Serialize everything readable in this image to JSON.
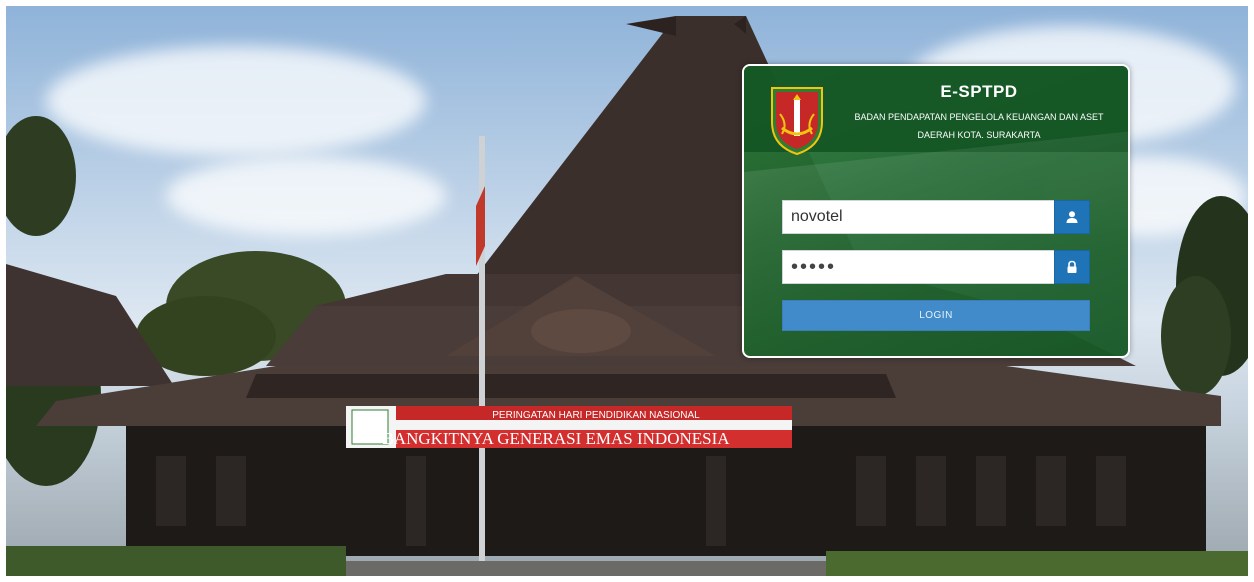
{
  "header": {
    "app_title": "E-SPTPD",
    "subtitle_line1": "BADAN PENDAPATAN PENGELOLA KEUANGAN DAN ASET",
    "subtitle_line2": "DAERAH KOTA. SURAKARTA"
  },
  "form": {
    "username_value": "novotel",
    "password_value": "•••••",
    "username_icon": "user-icon",
    "password_icon": "lock-icon",
    "login_label": "LOGIN"
  },
  "background": {
    "banner_line1": "PERINGATAN HARI PENDIDIKAN NASIONAL",
    "banner_line2": "BANGKITNYA GENERASI EMAS INDONESIA"
  },
  "colors": {
    "panel_green": "#1f662d",
    "header_green": "#125422",
    "addon_blue": "#1f74b7",
    "button_blue": "#428bca"
  }
}
